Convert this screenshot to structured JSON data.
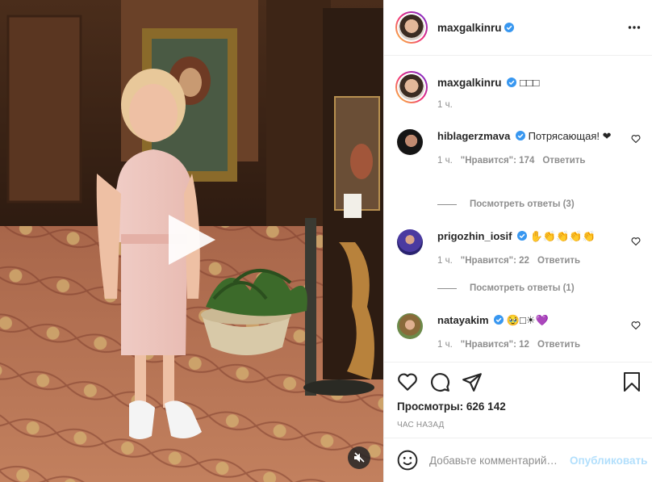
{
  "post": {
    "author": "maxgalkinru",
    "caption_text": "□□□",
    "caption_time": "1 ч.",
    "views_label": "Просмотры:",
    "views_count": "626 142",
    "posted_ago": "ЧАС НАЗАД"
  },
  "comments": [
    {
      "user": "hiblagerzmava",
      "text": "Потрясающая! ❤",
      "time": "1 ч.",
      "likes": "\"Нравится\": 174",
      "reply": "Ответить",
      "replies": "Посмотреть ответы (3)",
      "avatar": "dark-portrait"
    },
    {
      "user": "prigozhin_iosif",
      "text": "✋👏👏👏👏",
      "time": "1 ч.",
      "likes": "\"Нравится\": 22",
      "reply": "Ответить",
      "replies": "Посмотреть ответы (1)",
      "avatar": "stage-portrait"
    },
    {
      "user": "natayakim",
      "text": "🥹□☀💜",
      "time": "1 ч.",
      "likes": "\"Нравится\": 12",
      "reply": "Ответить",
      "avatar": "outdoor-portrait"
    }
  ],
  "add_comment": {
    "placeholder": "Добавьте комментарий…",
    "publish_label": "Опубликовать"
  },
  "icons": {
    "verified": "verified-badge-icon",
    "more": "more-options-icon",
    "like": "heart-icon",
    "comment": "comment-bubble-icon",
    "share": "paper-plane-icon",
    "save": "bookmark-icon",
    "emoji": "smiley-icon",
    "play": "play-icon",
    "mute": "speaker-muted-icon"
  },
  "colors": {
    "verified": "#3897f0",
    "publish_disabled": "#b2dffc",
    "secondary_text": "#8e8e8e"
  }
}
